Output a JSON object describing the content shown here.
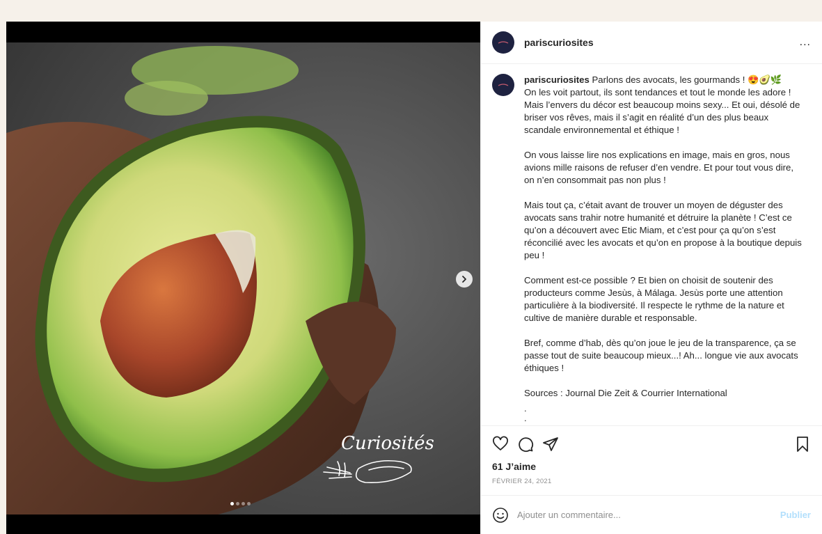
{
  "post": {
    "username": "pariscuriosites",
    "more_label": "...",
    "caption": {
      "username": "pariscuriosites",
      "paragraphs": [
        "Parlons des avocats, les gourmands ! 😍🥑🌿\nOn les voit partout, ils sont tendances et tout le monde les adore ! Mais l’envers du décor est beaucoup moins sexy... Et oui, désolé de briser vos rêves, mais il s’agit en réalité d’un des plus beaux scandale environnemental et éthique !",
        "On vous laisse lire nos explications en image, mais en gros, nous avions mille raisons de refuser d’en vendre. Et pour tout vous dire, on n’en consommait pas non plus !",
        "Mais tout ça, c’était avant de trouver un moyen de déguster des avocats sans trahir notre humanité et détruire la planète ! C’est ce qu’on a découvert avec Etic Miam, et c’est pour ça qu’on s’est réconcilié avec les avocats et qu’on en propose à la boutique depuis peu !",
        "Comment est-ce possible ? Et bien on choisit de soutenir des producteurs comme Jesùs, à Málaga. Jesùs porte une attention particulière à la biodiversité. Il respecte le rythme de la nature et cultive de manière durable et responsable.",
        "Bref, comme d’hab, dès qu’on joue le jeu de la transparence, ça se passe tout de suite beaucoup mieux...! Ah... longue vie aux avocats éthiques !",
        "Sources : Journal Die Zeit & Courrier International"
      ],
      "trailing_dots": [
        ".",
        "."
      ]
    },
    "likes": "61 J’aime",
    "date": "FÉVRIER 24, 2021",
    "comment": {
      "placeholder": "Ajouter un commentaire...",
      "publish_label": "Publier"
    },
    "media": {
      "logo_text": "Curiosités",
      "carousel_count": 4,
      "carousel_active": 1
    }
  },
  "colors": {
    "accent_disabled": "#b2dffc",
    "avatar_bg": "#1e2240",
    "muted_text": "#8e8e8e"
  },
  "icons": [
    "more-icon",
    "heart-icon",
    "comment-icon",
    "share-icon",
    "bookmark-icon",
    "emoji-icon",
    "chevron-right-icon"
  ]
}
